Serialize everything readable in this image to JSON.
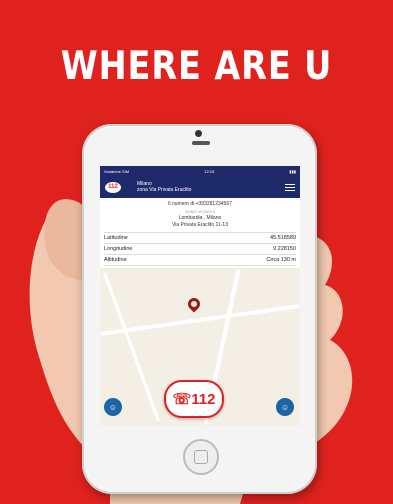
{
  "headline": "WHERE ARE U",
  "status": {
    "carrier": "Vodafone SIM",
    "time": "12:15"
  },
  "appbar": {
    "logo_text": "112",
    "city": "Milano",
    "street": "zona Via Privata Eraclito"
  },
  "info": {
    "number_line": "Il numero di +393281234567",
    "nearby": "SONO VICINO A",
    "region": "Lombardia , Milano",
    "street": "Via Privata Eraclito 11-13"
  },
  "rows": [
    {
      "label": "Latitudine",
      "value": "45.518589"
    },
    {
      "label": "Longitudine",
      "value": "9.228150"
    },
    {
      "label": "Altitudine",
      "value": "Circa 130 m"
    }
  ],
  "sos_label": "112",
  "icons": {
    "left_fab": "person-icon",
    "right_fab": "person-icon"
  },
  "colors": {
    "background": "#e0221e",
    "appbar": "#1f2a6b",
    "accent": "#1b64a8"
  }
}
